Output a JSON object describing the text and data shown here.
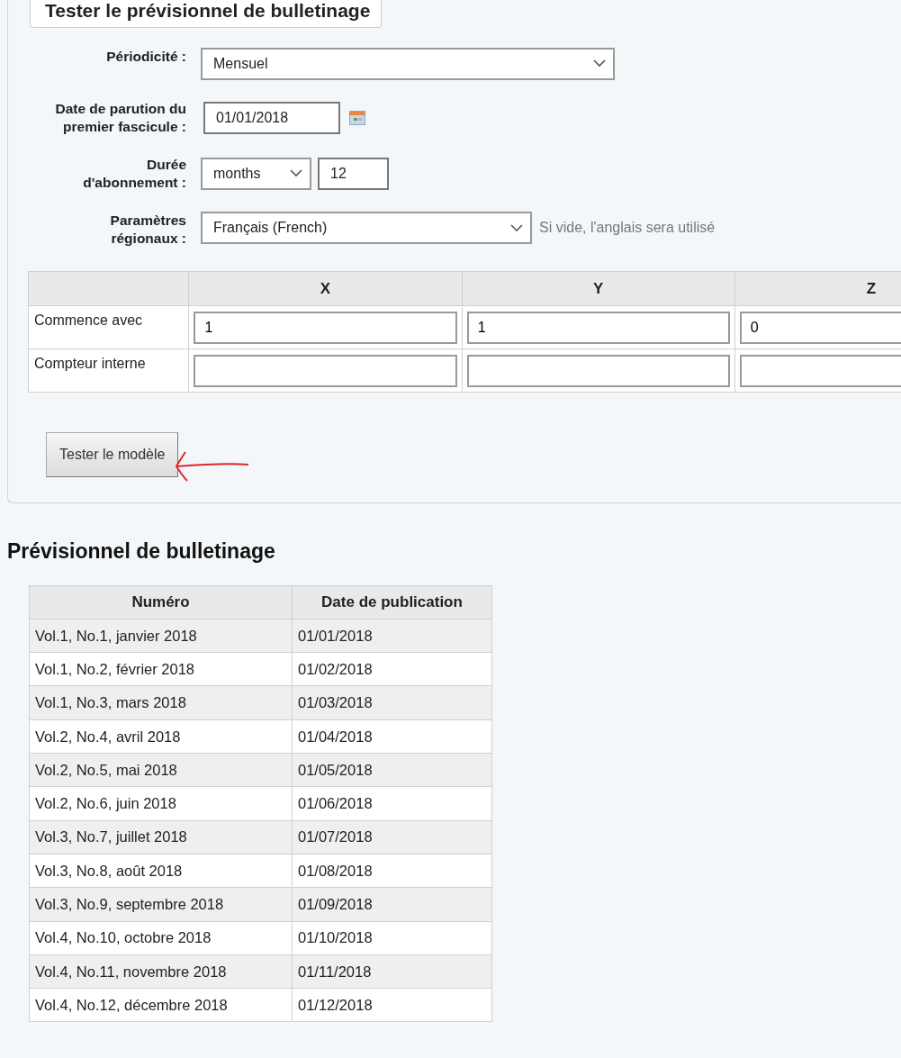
{
  "fieldset": {
    "legend": "Tester le prévisionnel de bulletinage",
    "fields": [
      {
        "kind": "select",
        "label": "Périodicité :",
        "value": "Mensuel"
      },
      {
        "kind": "date",
        "label": "Date de parution du premier fascicule :",
        "value": "01/01/2018"
      },
      {
        "kind": "duration",
        "label": "Durée d'abonnement :",
        "unit": "months",
        "value": "12"
      },
      {
        "kind": "locale",
        "label": "Paramètres régionaux :",
        "value": "Français (French)",
        "hint": "Si vide, l'anglais sera utilisé"
      }
    ],
    "numbering_table": {
      "columns": [
        "X",
        "Y",
        "Z"
      ],
      "rows": [
        {
          "label": "Commence avec",
          "values": [
            "1",
            "1",
            "0"
          ]
        },
        {
          "label": "Compteur interne"
        }
      ]
    },
    "button": "Tester le modèle"
  },
  "preview": {
    "title": "Prévisionnel de bulletinage",
    "columns": [
      "Numéro",
      "Date de publication"
    ],
    "rows": [
      [
        "Vol.1, No.1, janvier 2018",
        "01/01/2018"
      ],
      [
        "Vol.1, No.2, février 2018",
        "01/02/2018"
      ],
      [
        "Vol.1, No.3, mars 2018",
        "01/03/2018"
      ],
      [
        "Vol.2, No.4, avril 2018",
        "01/04/2018"
      ],
      [
        "Vol.2, No.5, mai 2018",
        "01/05/2018"
      ],
      [
        "Vol.2, No.6, juin 2018",
        "01/06/2018"
      ],
      [
        "Vol.3, No.7, juillet 2018",
        "01/07/2018"
      ],
      [
        "Vol.3, No.8, août 2018",
        "01/08/2018"
      ],
      [
        "Vol.3, No.9, septembre 2018",
        "01/09/2018"
      ],
      [
        "Vol.4, No.10, octobre 2018",
        "01/10/2018"
      ],
      [
        "Vol.4, No.11, novembre 2018",
        "01/11/2018"
      ],
      [
        "Vol.4, No.12, décembre 2018",
        "01/12/2018"
      ]
    ]
  }
}
